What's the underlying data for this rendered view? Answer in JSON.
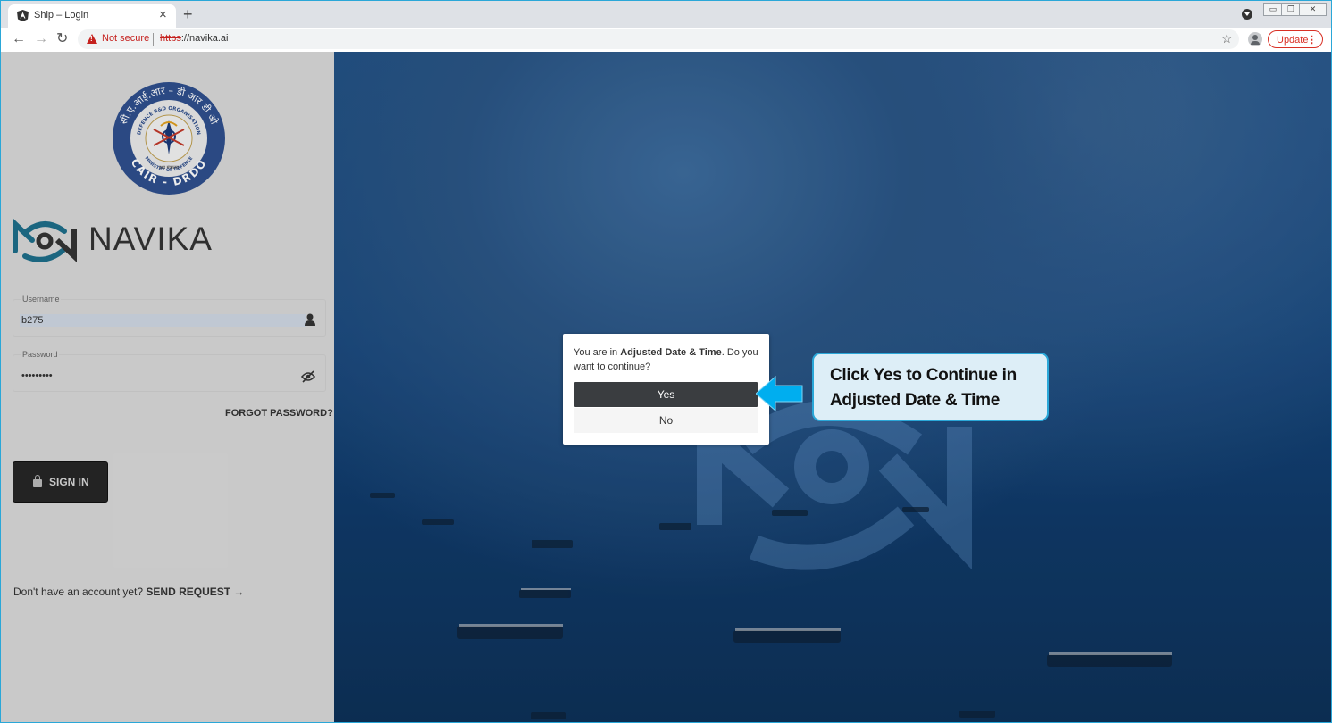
{
  "browser": {
    "tab_title": "Ship – Login",
    "tab_close": "×",
    "new_tab": "+",
    "address": {
      "security_label": "Not secure",
      "url_scheme": "https",
      "url_rest": "://navika.ai"
    },
    "update_label": "Update"
  },
  "login": {
    "emblem": {
      "top_text": "सी.ए.आई.आर – डी आर डी ओ",
      "inner_text": "DEFENCE R&D ORGANISATION",
      "motto": "रक्षा मंत्रालय",
      "ministry": "MINISTRY OF DEFENCE",
      "bottom_text": "CAIR - DRDO"
    },
    "brand_name": "NAVIKA",
    "username": {
      "label": "Username",
      "value": "b275"
    },
    "password": {
      "label": "Password",
      "value": "•••••••••"
    },
    "forgot_password": "FORGOT PASSWORD?",
    "sign_in": "SIGN IN",
    "request_prompt": "Don't have an account yet?",
    "request_link": "SEND REQUEST →"
  },
  "dialog": {
    "message_before": "You are in ",
    "message_bold": "Adjusted Date & Time",
    "message_after": ". Do you want to continue?",
    "yes_label": "Yes",
    "no_label": "No"
  },
  "annotation": {
    "line1": "Click Yes to Continue in",
    "line2": "Adjusted Date & Time"
  },
  "colors": {
    "accent_border": "#2aa7d8",
    "callout_bg": "#ddeef7",
    "arrow": "#00aeef",
    "warning": "#c5221f",
    "navika_teal": "#1e6e8a"
  }
}
